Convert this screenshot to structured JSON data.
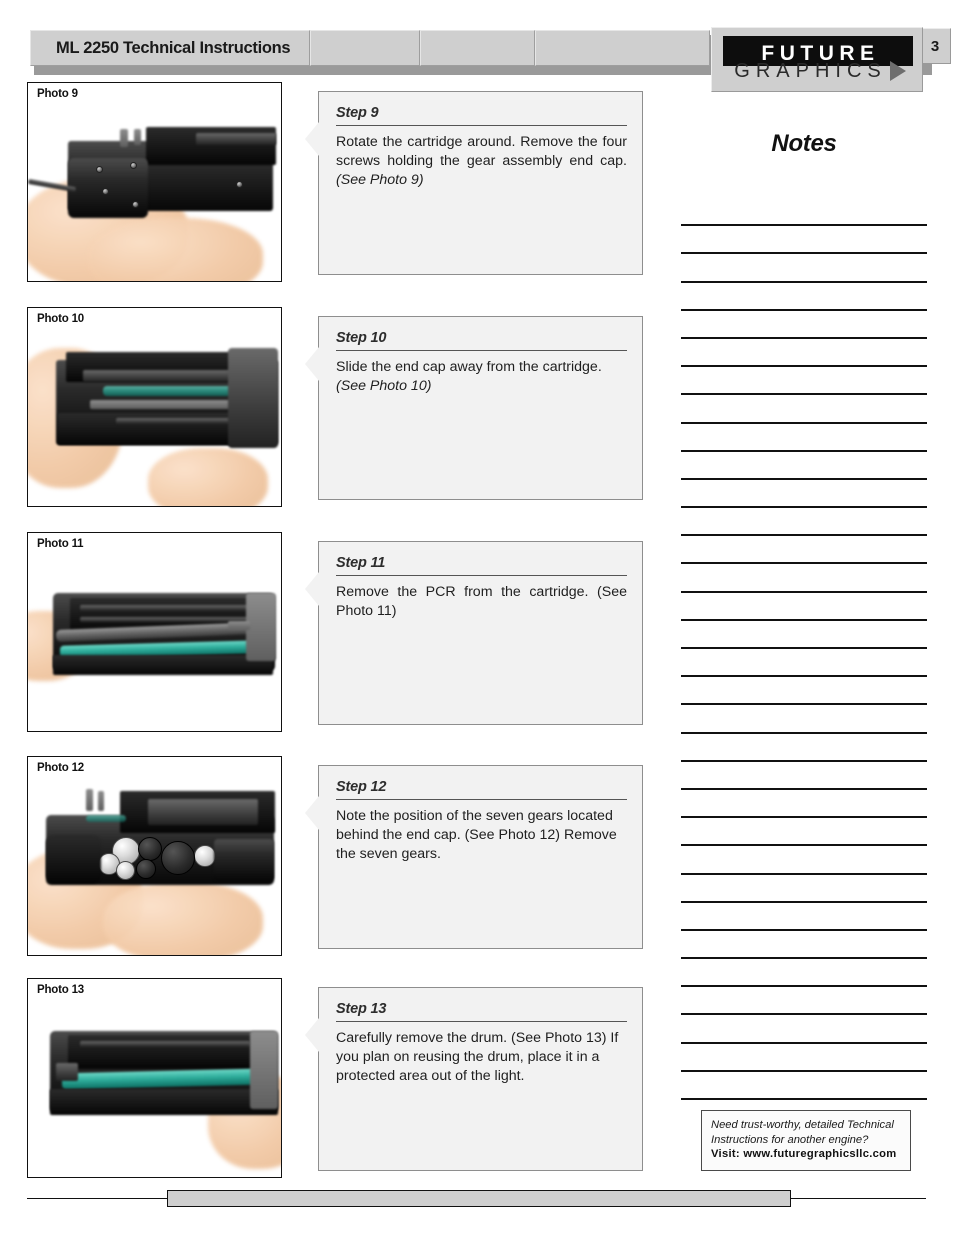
{
  "header": {
    "title": "ML 2250 Technical Instructions",
    "page_number": "3",
    "logo": {
      "top_word": "FUTURE",
      "bottom_word": "GRAPHICS",
      "arrow_icon": "right-triangle-icon"
    },
    "segments": [
      "ML 2250 Technical Instructions",
      "",
      "",
      ""
    ]
  },
  "steps": [
    {
      "photo_label": "Photo 9",
      "step_title": "Step 9",
      "body_main": "Rotate the cartridge around. Remove the four screws holding the gear assembly end cap. ",
      "body_italic": "(See Photo 9)",
      "justified": true
    },
    {
      "photo_label": "Photo 10",
      "step_title": "Step 10",
      "body_main": "Slide the end cap away from the cartridge. ",
      "body_italic": "(See Photo 10)",
      "justified": false
    },
    {
      "photo_label": "Photo 11",
      "step_title": "Step 11",
      "body_main": "Remove the PCR from the cartridge. (See Photo 11)",
      "body_italic": "",
      "justified": true
    },
    {
      "photo_label": "Photo 12",
      "step_title": "Step 12",
      "body_main": "Note the position of the seven gears located behind the end cap. (See Photo 12) Remove the seven gears.",
      "body_italic": "",
      "justified": false
    },
    {
      "photo_label": "Photo 13",
      "step_title": "Step 13",
      "body_main": "Carefully remove the drum. (See Photo 13) If you plan on reusing the drum, place it in a protected area out of the light.",
      "body_italic": "",
      "justified": false
    }
  ],
  "notes": {
    "title": "Notes",
    "line_count": 32
  },
  "promo": {
    "line1": "Need trust-worthy, detailed Technical",
    "line2": "Instructions for another engine?",
    "line3": "Visit: www.futuregraphicsllc.com"
  },
  "colors": {
    "header_gray": "#cfcfcf",
    "step_box_bg": "#f2f2f2",
    "rule_black": "#111111"
  }
}
